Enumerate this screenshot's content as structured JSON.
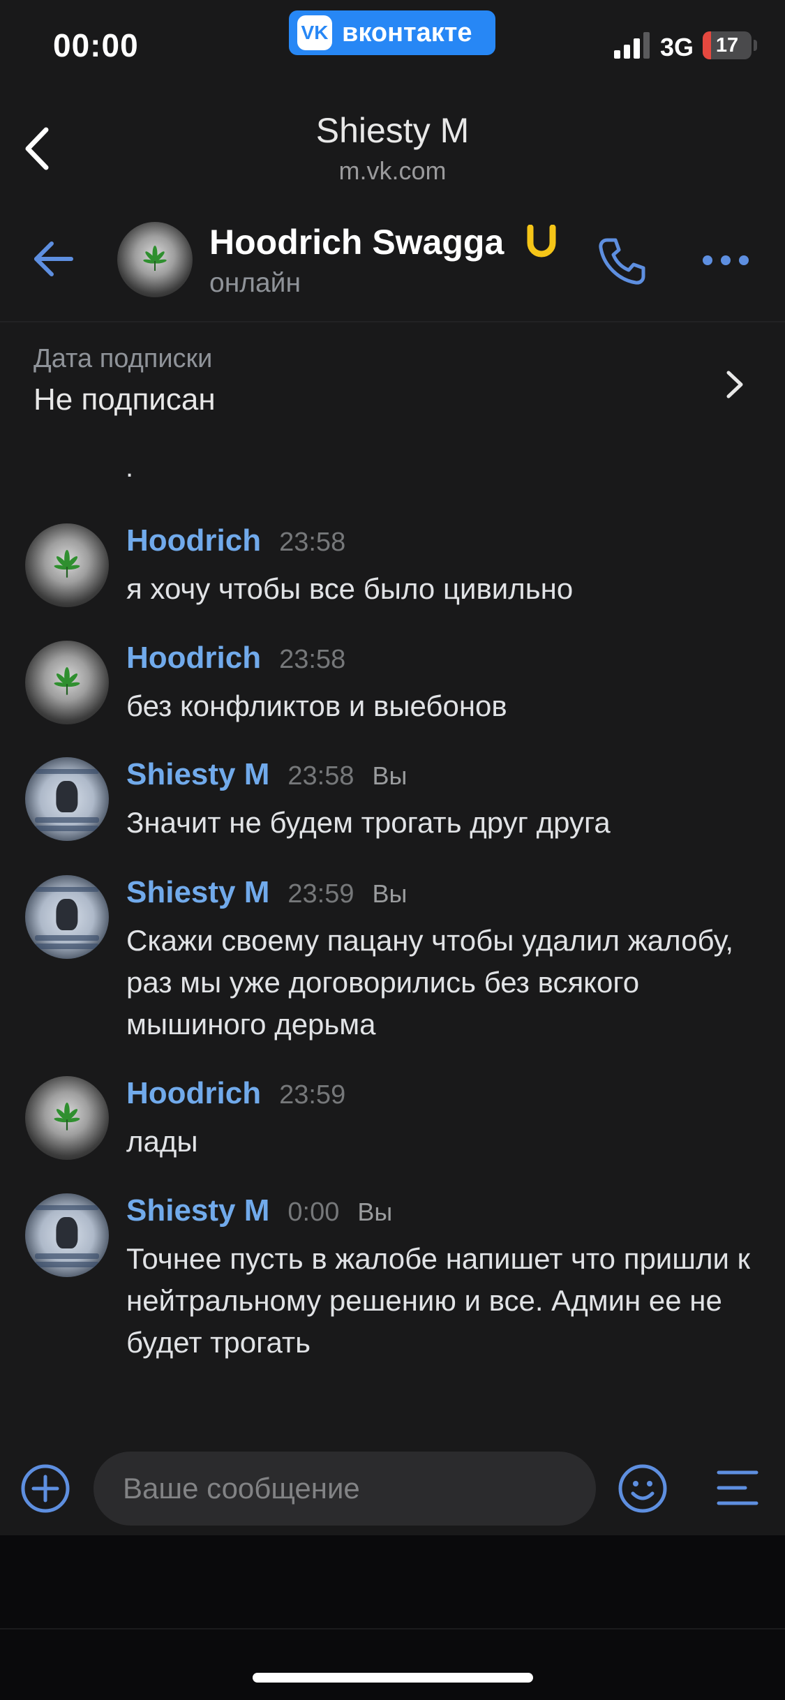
{
  "status_bar": {
    "time": "00:00",
    "badge_logo": "VK",
    "badge_text": "вконтакте",
    "network": "3G",
    "battery_percent": 17,
    "battery_label": "17",
    "battery_color": "#e5483f"
  },
  "browser": {
    "title": "Shiesty M",
    "url": "m.vk.com"
  },
  "chat_header": {
    "name": "Hoodrich Swagga",
    "status": "онлайн",
    "verified_color": "#f5c518",
    "accent": "#5e8fe0",
    "icons": [
      "back-arrow-icon",
      "phone-icon",
      "more-dots-icon"
    ]
  },
  "subscription": {
    "label": "Дата подписки",
    "value": "Не подписан"
  },
  "messages": [
    {
      "text": "."
    },
    {
      "author": "Hoodrich",
      "time": "23:58",
      "you": "",
      "avatar": "weed",
      "text": "я хочу чтобы все было цивильно"
    },
    {
      "author": "Hoodrich",
      "time": "23:58",
      "you": "",
      "avatar": "weed",
      "text": "без конфликтов и выебонов"
    },
    {
      "author": "Shiesty M",
      "time": "23:58",
      "you": "Вы",
      "avatar": "poster",
      "text": "Значит не будем трогать друг друга"
    },
    {
      "author": "Shiesty M",
      "time": "23:59",
      "you": "Вы",
      "avatar": "poster",
      "text": "Скажи своему пацану чтобы удалил жалобу, раз мы уже договорились без всякого мышиного дерьма"
    },
    {
      "author": "Hoodrich",
      "time": "23:59",
      "you": "",
      "avatar": "weed",
      "text": "лады"
    },
    {
      "author": "Shiesty M",
      "time": "0:00",
      "you": "Вы",
      "avatar": "poster",
      "text": "Точнее пусть в жалобе напишет что пришли к нейтральному решению и все. Админ ее не будет трогать"
    }
  ],
  "composer": {
    "placeholder": "Ваше сообщение",
    "icons": [
      "plus-circle-icon",
      "emoji-icon",
      "menu-lines-icon"
    ]
  },
  "colors": {
    "background": "#19191a",
    "author_name": "#71aaeb",
    "vk_blue": "#2787f5"
  }
}
